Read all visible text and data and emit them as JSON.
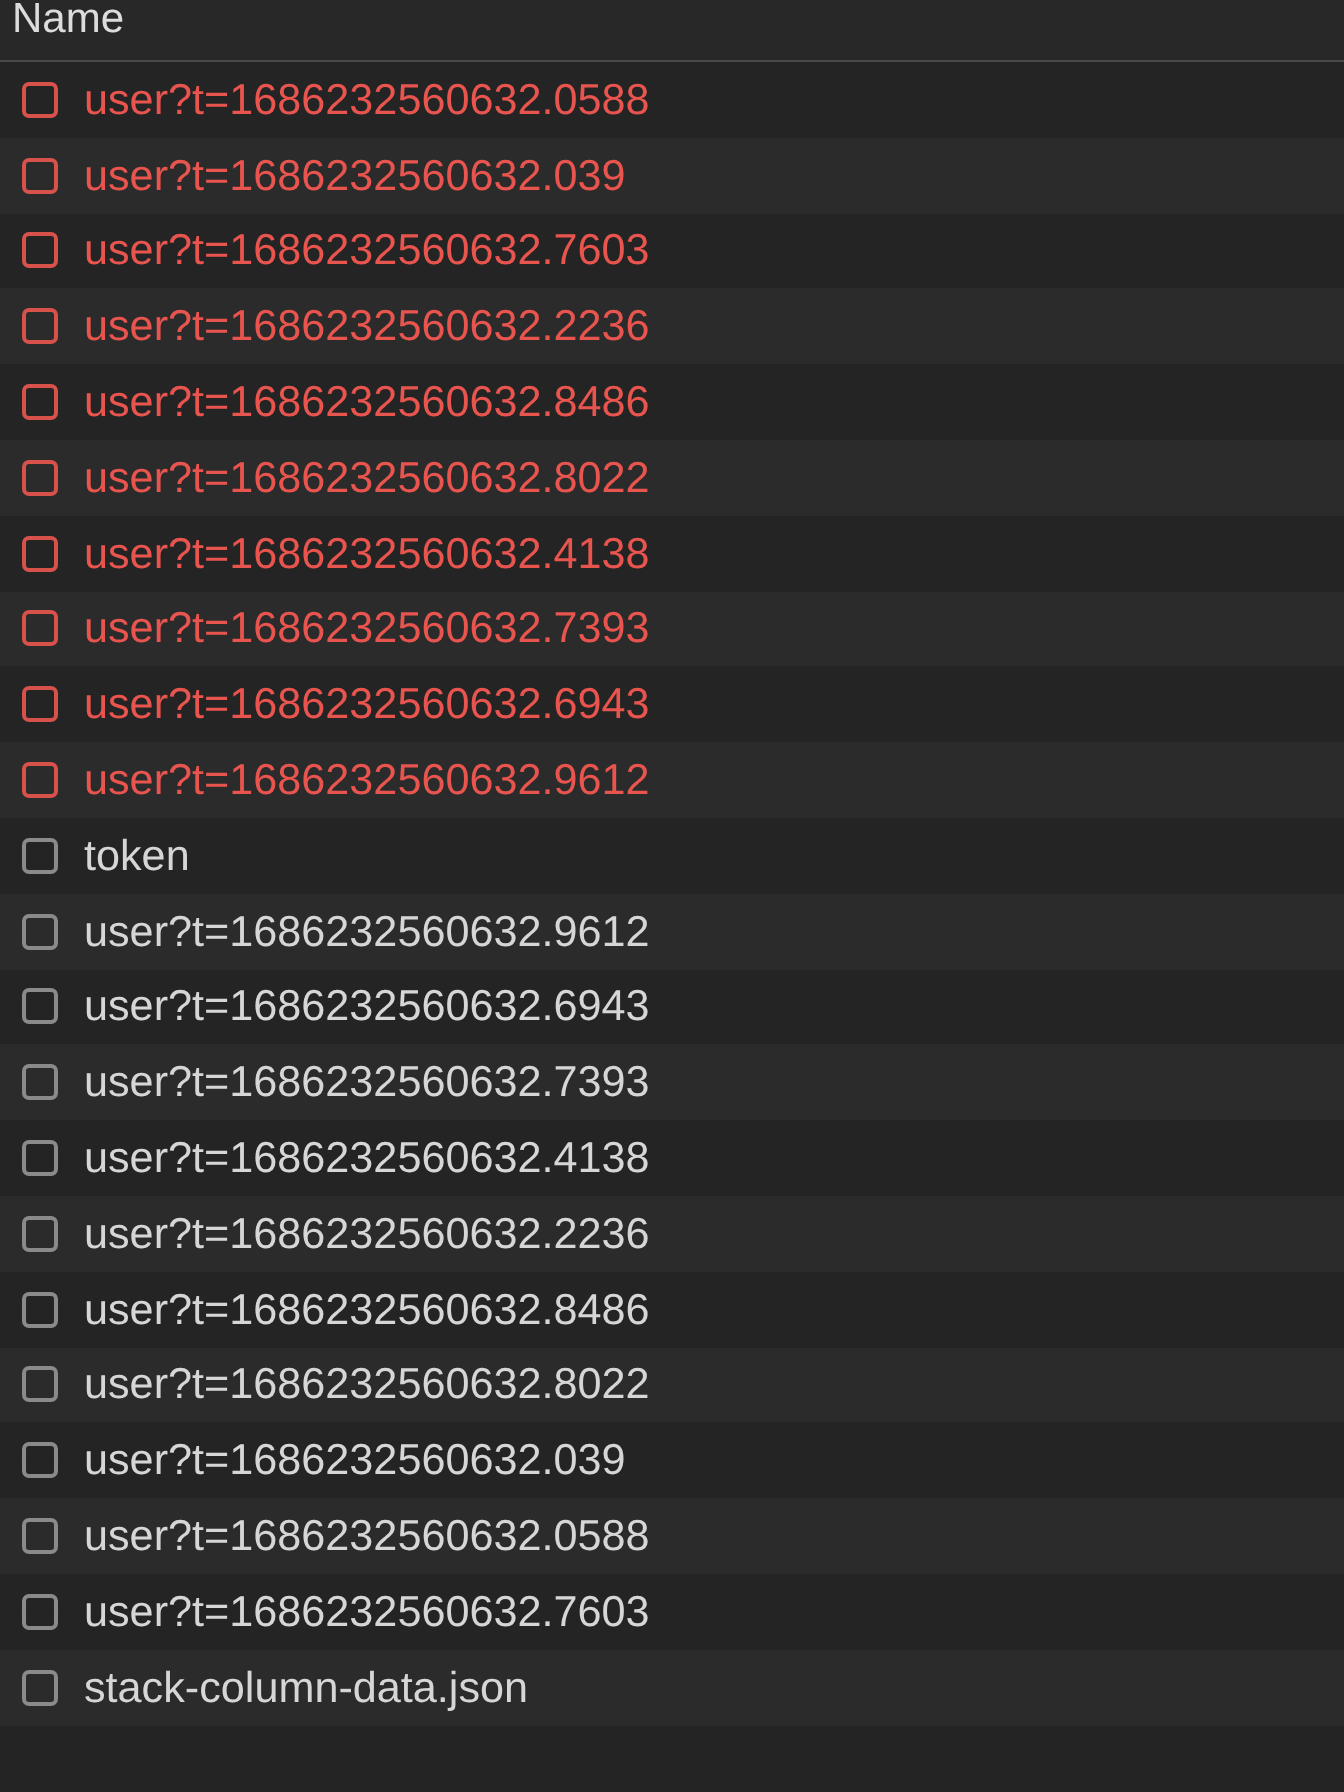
{
  "header": {
    "title": "Name"
  },
  "requests": [
    {
      "name": "user?t=1686232560632.0588",
      "failed": true
    },
    {
      "name": "user?t=1686232560632.039",
      "failed": true
    },
    {
      "name": "user?t=1686232560632.7603",
      "failed": true
    },
    {
      "name": "user?t=1686232560632.2236",
      "failed": true
    },
    {
      "name": "user?t=1686232560632.8486",
      "failed": true
    },
    {
      "name": "user?t=1686232560632.8022",
      "failed": true
    },
    {
      "name": "user?t=1686232560632.4138",
      "failed": true
    },
    {
      "name": "user?t=1686232560632.7393",
      "failed": true
    },
    {
      "name": "user?t=1686232560632.6943",
      "failed": true
    },
    {
      "name": "user?t=1686232560632.9612",
      "failed": true
    },
    {
      "name": "token",
      "failed": false
    },
    {
      "name": "user?t=1686232560632.9612",
      "failed": false
    },
    {
      "name": "user?t=1686232560632.6943",
      "failed": false
    },
    {
      "name": "user?t=1686232560632.7393",
      "failed": false
    },
    {
      "name": "user?t=1686232560632.4138",
      "failed": false
    },
    {
      "name": "user?t=1686232560632.2236",
      "failed": false
    },
    {
      "name": "user?t=1686232560632.8486",
      "failed": false
    },
    {
      "name": "user?t=1686232560632.8022",
      "failed": false
    },
    {
      "name": "user?t=1686232560632.039",
      "failed": false
    },
    {
      "name": "user?t=1686232560632.0588",
      "failed": false
    },
    {
      "name": "user?t=1686232560632.7603",
      "failed": false
    },
    {
      "name": "stack-column-data.json",
      "failed": false
    }
  ]
}
